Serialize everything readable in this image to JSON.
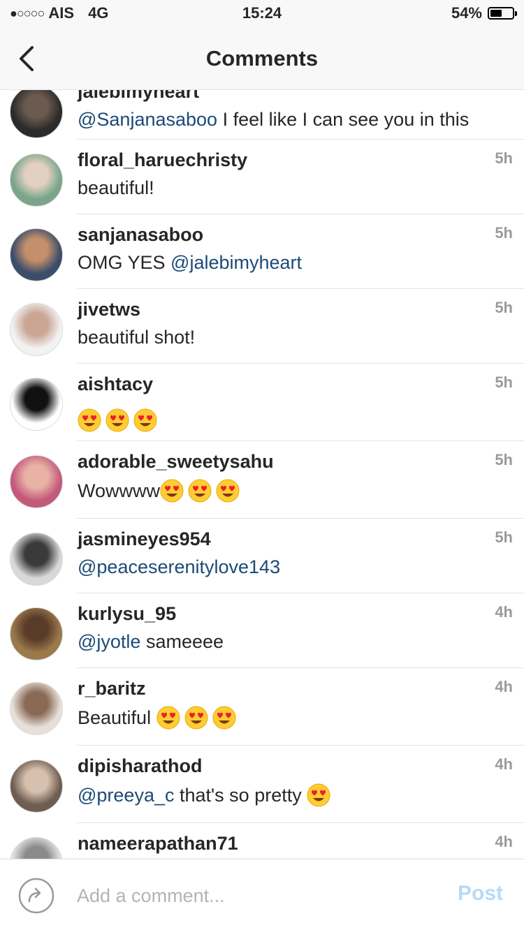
{
  "status_bar": {
    "signal_dots": "●○○○○",
    "carrier": "AIS",
    "network": "4G",
    "time": "15:24",
    "battery_percent_text": "54%",
    "battery_level": 0.54
  },
  "nav": {
    "title": "Comments",
    "back_icon": "chevron-left-icon"
  },
  "comments": [
    {
      "username": "jalebimyheart",
      "mention": "@Sanjanasaboo",
      "text": " I feel like I can see you in this",
      "time": "",
      "emoji_count": 0
    },
    {
      "username": "floral_haruechristy",
      "mention": "",
      "text": "beautiful!",
      "time": "5h",
      "emoji_count": 0
    },
    {
      "username": "sanjanasaboo",
      "mention": "",
      "text": "OMG YES ",
      "mention_after": "@jalebimyheart",
      "time": "5h",
      "emoji_count": 0
    },
    {
      "username": "jivetws",
      "mention": "",
      "text": "beautiful shot!",
      "time": "5h",
      "emoji_count": 0
    },
    {
      "username": "aishtacy",
      "mention": "",
      "text": "",
      "time": "5h",
      "emoji_count": 3,
      "emoji": "heart-eyes-emoji"
    },
    {
      "username": "adorable_sweetysahu",
      "mention": "",
      "text": "Wowwww",
      "time": "5h",
      "emoji_count": 3,
      "emoji": "heart-eyes-emoji"
    },
    {
      "username": "jasmineyes954",
      "mention": "@peaceserenitylove143",
      "text": "",
      "time": "5h",
      "emoji_count": 0
    },
    {
      "username": "kurlysu_95",
      "mention": "@jyotle",
      "text": " sameeee",
      "time": "4h",
      "emoji_count": 0
    },
    {
      "username": "r_baritz",
      "mention": "",
      "text": "Beautiful ",
      "time": "4h",
      "emoji_count": 3,
      "emoji": "heart-eyes-emoji"
    },
    {
      "username": "dipisharathod",
      "mention": "@preeya_c",
      "text": " that's so pretty ",
      "time": "4h",
      "emoji_count": 1,
      "emoji": "heart-eyes-emoji"
    },
    {
      "username": "nameerapathan71",
      "mention": "",
      "text": "",
      "time": "4h",
      "emoji_count": 0
    }
  ],
  "composer": {
    "share_icon": "share-arrow-icon",
    "placeholder": "Add a comment...",
    "post_label": "Post"
  },
  "colors": {
    "mention": "#1c4a77",
    "time": "#9a9a9a",
    "post_disabled": "#b6dbf5",
    "bar_background": "#f8f8f8"
  }
}
